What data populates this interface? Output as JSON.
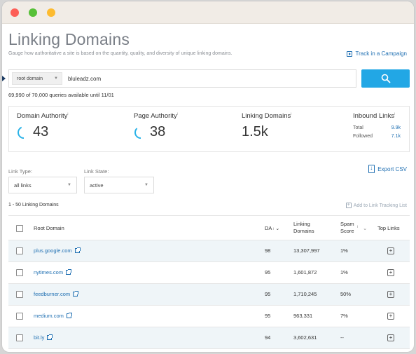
{
  "window": {
    "controls": [
      "close",
      "minimize",
      "maximize"
    ]
  },
  "header": {
    "title": "Linking Domains",
    "subtitle": "Gauge how authoritative a site is based on the quantity, quality, and diversity of unique linking domains.",
    "track_campaign": "Track in a Campaign"
  },
  "search": {
    "scope": "root domain",
    "query": "bluleadz.com",
    "queries_note": "69,990 of 70,000 queries available until 11/01"
  },
  "metrics": {
    "domain_authority": {
      "label": "Domain Authority",
      "value": "43",
      "percent": 43
    },
    "page_authority": {
      "label": "Page Authority",
      "value": "38",
      "percent": 38
    },
    "linking_domains": {
      "label": "Linking Domains",
      "value": "1.5k"
    },
    "inbound_links": {
      "label": "Inbound Links",
      "total_label": "Total",
      "total_value": "9.9k",
      "followed_label": "Followed",
      "followed_value": "7.1k"
    },
    "info_mark": "i"
  },
  "filters": {
    "link_type_label": "Link Type:",
    "link_type_value": "all links",
    "link_state_label": "Link State:",
    "link_state_value": "active",
    "export": "Export CSV"
  },
  "list": {
    "range": "1 - 50 Linking Domains",
    "add_tracking": "Add to Link Tracking List"
  },
  "table": {
    "headers": {
      "root_domain": "Root Domain",
      "da": "DA",
      "linking_domains_1": "Linking",
      "linking_domains_2": "Domains",
      "spam_1": "Spam",
      "spam_2": "Score",
      "top_links": "Top Links"
    },
    "rows": [
      {
        "domain": "plus.google.com",
        "da": "98",
        "linking": "13,307,997",
        "spam": "1%"
      },
      {
        "domain": "nytimes.com",
        "da": "95",
        "linking": "1,601,872",
        "spam": "1%"
      },
      {
        "domain": "feedburner.com",
        "da": "95",
        "linking": "1,710,245",
        "spam": "50%"
      },
      {
        "domain": "medium.com",
        "da": "95",
        "linking": "963,331",
        "spam": "7%"
      },
      {
        "domain": "bit.ly",
        "da": "94",
        "linking": "3,602,631",
        "spam": "--"
      }
    ]
  },
  "colors": {
    "accent": "#22a7e5",
    "link": "#1f6fb2",
    "ring": "#2bb3e8",
    "alt_row": "#eff5f8"
  }
}
